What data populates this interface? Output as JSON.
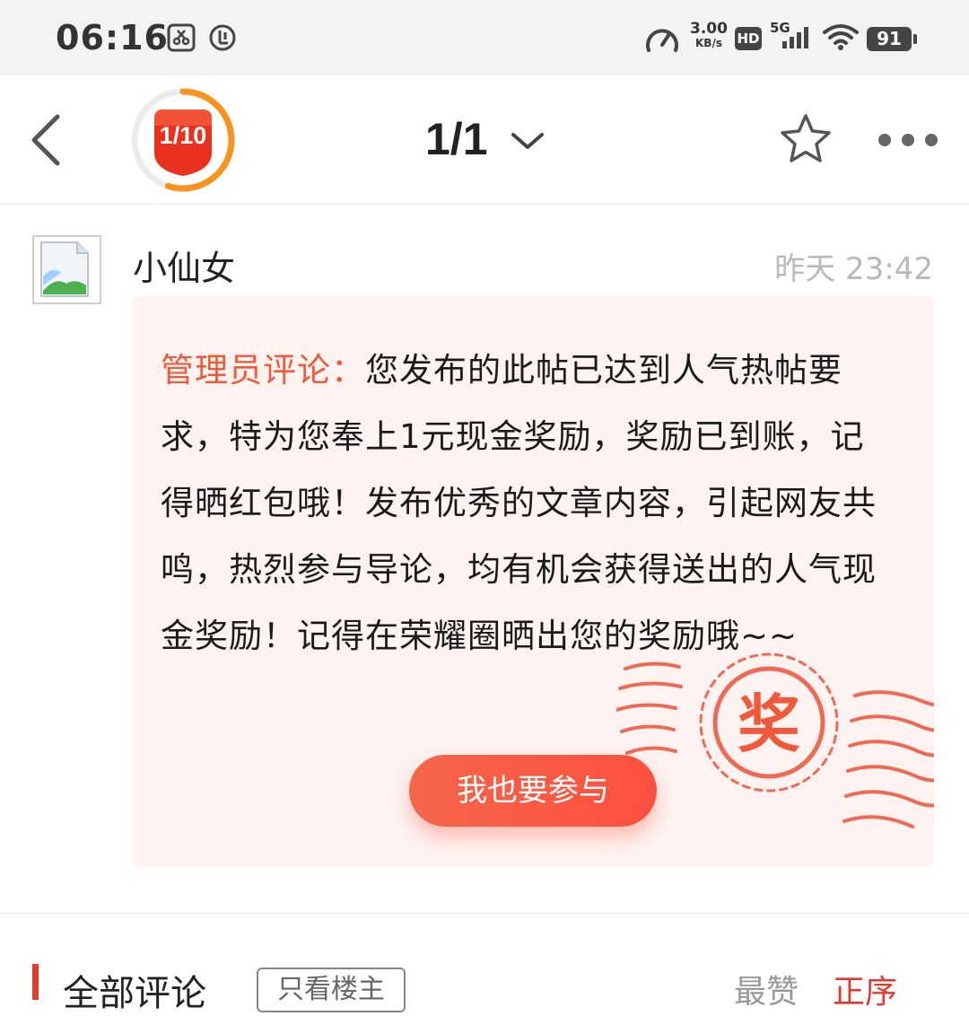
{
  "status_bar": {
    "time": "06:16",
    "net_speed_value": "3.00",
    "net_speed_unit": "KB/s",
    "hd_label": "HD",
    "network_label": "5G",
    "battery": "91"
  },
  "header": {
    "progress_badge": "1/10",
    "page_indicator": "1/1",
    "progress_fraction": 0.1
  },
  "post": {
    "username": "小仙女",
    "timestamp": "昨天 23:42",
    "admin_label": "管理员评论：",
    "body": "您发布的此帖已达到人气热帖要求，特为您奉上1元现金奖励，奖励已到账，记得晒红包哦！发布优秀的文章内容，引起网友共鸣，热烈参与导论，均有机会获得送出的人气现金奖励！记得在荣耀圈晒出您的奖励哦~~",
    "stamp_text": "奖",
    "join_button": "我也要参与"
  },
  "comments": {
    "title": "全部评论",
    "only_host": "只看楼主",
    "sort_hot": "最赞",
    "sort_order": "正序"
  },
  "colors": {
    "accent": "#ef5a3b",
    "card_bg": "#fef3f1",
    "comments_bar": "#e13b2f"
  }
}
